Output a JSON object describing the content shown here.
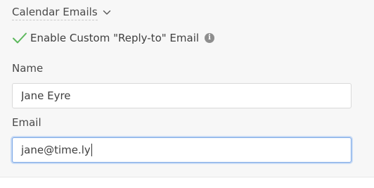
{
  "section": {
    "title": "Calendar Emails",
    "chevron_icon": "chevron-down-icon"
  },
  "reply_to": {
    "label": "Enable Custom \"Reply-to\" Email",
    "checked": true,
    "check_icon": "checkmark-icon",
    "check_color": "#5cb85c",
    "info_icon": "info-icon",
    "info_glyph": "i"
  },
  "fields": {
    "name": {
      "label": "Name",
      "value": "Jane Eyre"
    },
    "email": {
      "label": "Email",
      "value": "jane@time.ly"
    }
  },
  "colors": {
    "focus_border": "#7aa7e6",
    "panel_bg": "#f7f7f7"
  }
}
